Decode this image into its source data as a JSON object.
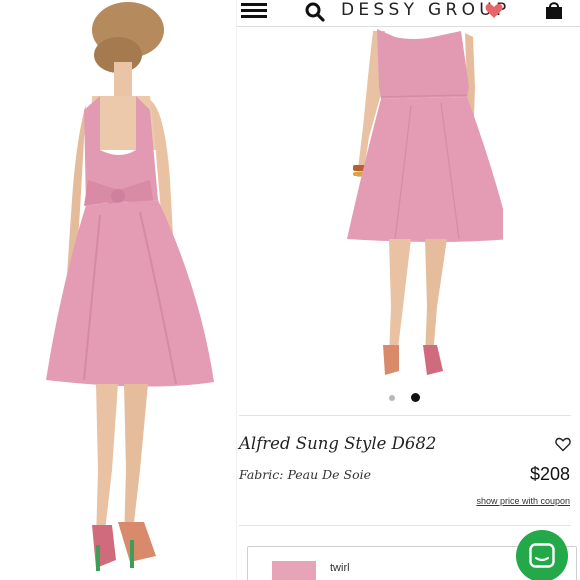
{
  "header": {
    "brand": "DESSY GROUP",
    "icons": [
      "hamburger-menu-icon",
      "search-icon",
      "heart-icon",
      "shopping-bag-icon"
    ],
    "heart_color": "#e8646a"
  },
  "gallery": {
    "total_slides": 2,
    "active_slide": 2
  },
  "product": {
    "title": "Alfred Sung Style D682",
    "fabric": "Fabric: Peau De Soie",
    "price": "$208",
    "coupon_link": "show price with coupon"
  },
  "color_selector": {
    "selected_color": "twirl",
    "swatch_color": "#e7a4b9"
  },
  "chat": {
    "icon": "chat-bubble-icon",
    "color": "#23a84a"
  },
  "colors": {
    "dress_pink": "#e29ab2",
    "accent_green": "#23a84a"
  }
}
